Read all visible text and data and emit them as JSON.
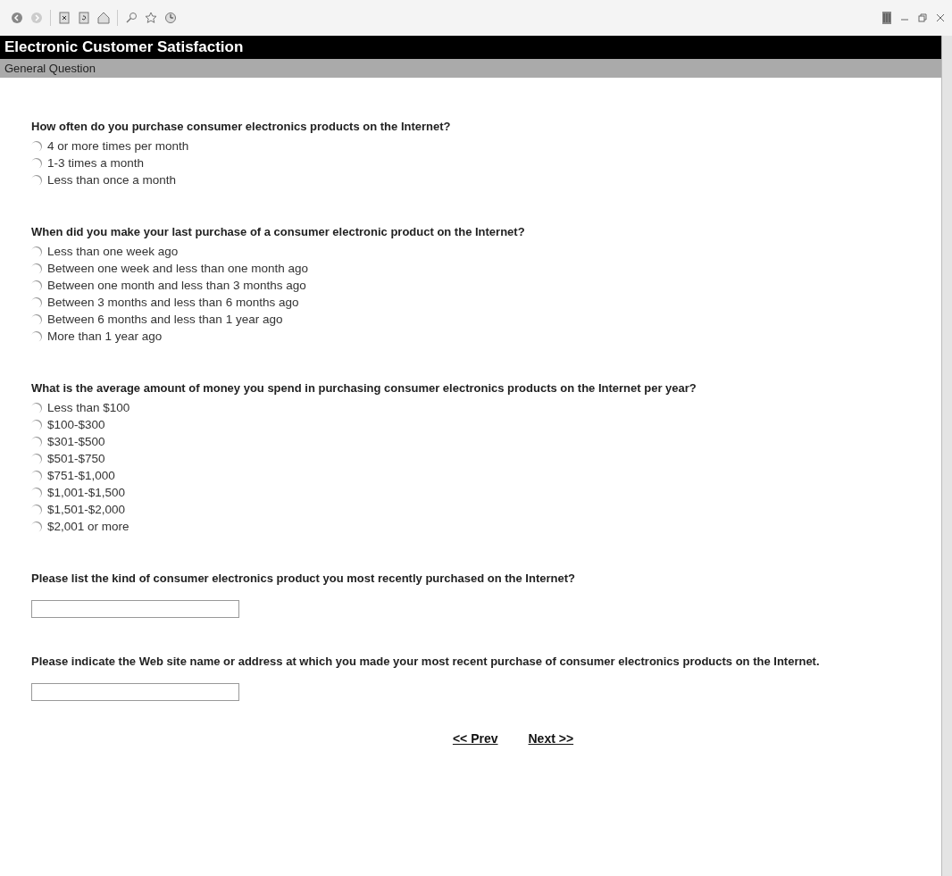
{
  "header": {
    "title": "Electronic Customer Satisfaction",
    "section": "General Question"
  },
  "questions": [
    {
      "kind": "choice",
      "text": "How often do you purchase consumer electronics products on the Internet?",
      "options": [
        {
          "label": "4 or more times per month",
          "selected": false
        },
        {
          "label": "1-3 times a month",
          "selected": false
        },
        {
          "label": "Less than once a month",
          "selected": false
        }
      ]
    },
    {
      "kind": "choice",
      "text": "When did you make your last purchase of a consumer electronic product on the Internet?",
      "options": [
        {
          "label": "Less than one week ago",
          "selected": false
        },
        {
          "label": "Between one week and less than one month ago",
          "selected": false
        },
        {
          "label": "Between one month and less than 3 months ago",
          "selected": false
        },
        {
          "label": "Between 3 months and less than 6 months ago",
          "selected": false
        },
        {
          "label": "Between 6 months and less than 1 year ago",
          "selected": false
        },
        {
          "label": "More than 1 year ago",
          "selected": false
        }
      ]
    },
    {
      "kind": "choice",
      "text": "What is the average amount of money you spend in purchasing consumer electronics products on the Internet per year?",
      "options": [
        {
          "label": "Less than $100",
          "selected": false
        },
        {
          "label": "$100-$300",
          "selected": false
        },
        {
          "label": "$301-$500",
          "selected": false
        },
        {
          "label": "$501-$750",
          "selected": false
        },
        {
          "label": "$751-$1,000",
          "selected": false
        },
        {
          "label": "$1,001-$1,500",
          "selected": false
        },
        {
          "label": "$1,501-$2,000",
          "selected": false
        },
        {
          "label": "$2,001 or more",
          "selected": false
        }
      ]
    },
    {
      "kind": "text",
      "text": "Please list the kind of consumer electronics product you most recently purchased on the Internet?"
    },
    {
      "kind": "text",
      "text": "Please indicate the Web site name or address at which you made your most recent purchase of consumer electronics products on the Internet."
    }
  ],
  "nav": [
    "<< Prev",
    "Next >>"
  ]
}
